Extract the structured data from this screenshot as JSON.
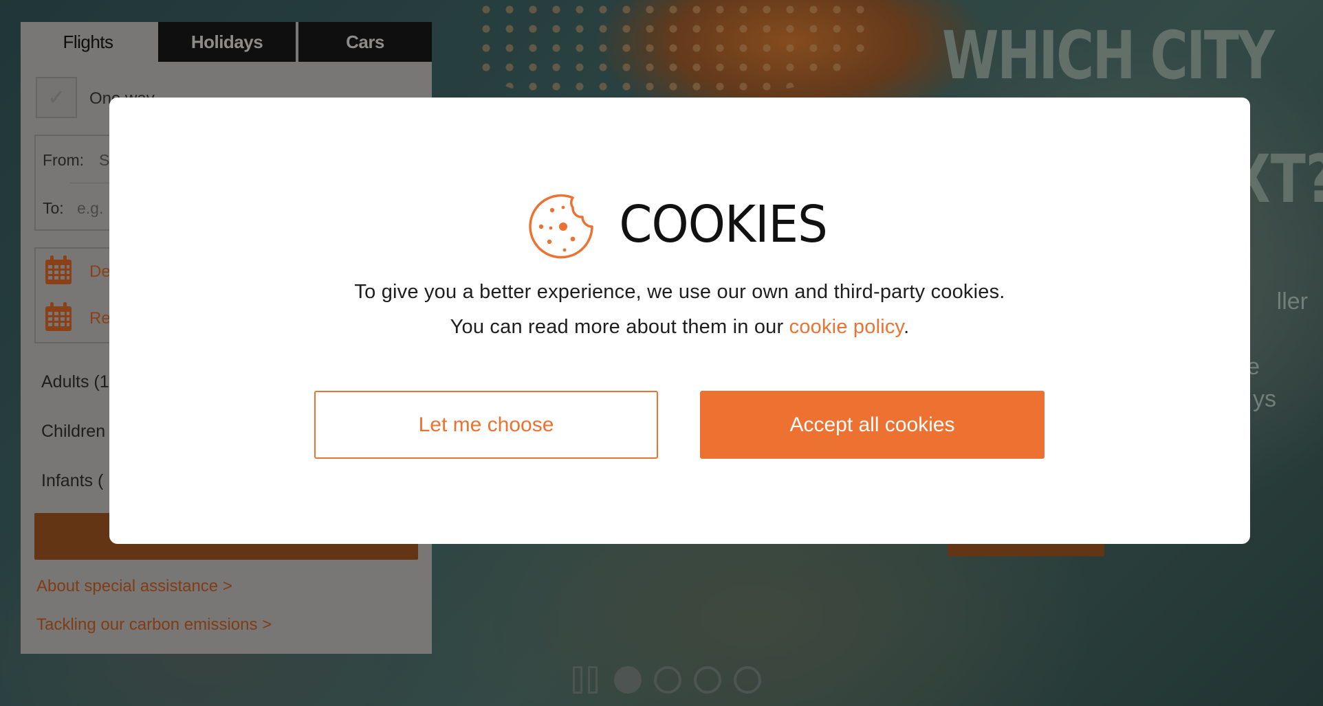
{
  "tabs": [
    {
      "label": "Flights",
      "active": true
    },
    {
      "label": "Holidays",
      "active": false
    },
    {
      "label": "Cars",
      "active": false
    }
  ],
  "search": {
    "oneway_label": "One way",
    "from_label": "From:",
    "from_value": "S",
    "to_label": "To:",
    "to_placeholder": "e.g.",
    "depart_label": "De",
    "return_label": "Re",
    "adults_label": "Adults (1",
    "children_label": "Children",
    "infants_label": "Infants (",
    "link_assistance": "About special assistance >",
    "link_carbon": "Tackling our carbon emissions >"
  },
  "hero": {
    "headline_1": "WHICH CITY",
    "headline_2": "XT?",
    "copy_1": "ller",
    "copy_2": "e",
    "copy_3": "ys"
  },
  "carousel": {
    "slide_count": 4,
    "active_index": 0
  },
  "cookie_modal": {
    "title": "COOKIES",
    "line_1": "To give you a better experience, we use our own and third-party cookies.",
    "line_2_prefix": "You can read more about them in our ",
    "policy_link": "cookie policy",
    "line_2_suffix": ".",
    "choose_button": "Let me choose",
    "accept_button": "Accept all cookies"
  },
  "colors": {
    "accent": "#ed7130",
    "panel_bg": "#a7a5a3",
    "tab_dark": "#151515",
    "modal_bg": "#ffffff"
  }
}
